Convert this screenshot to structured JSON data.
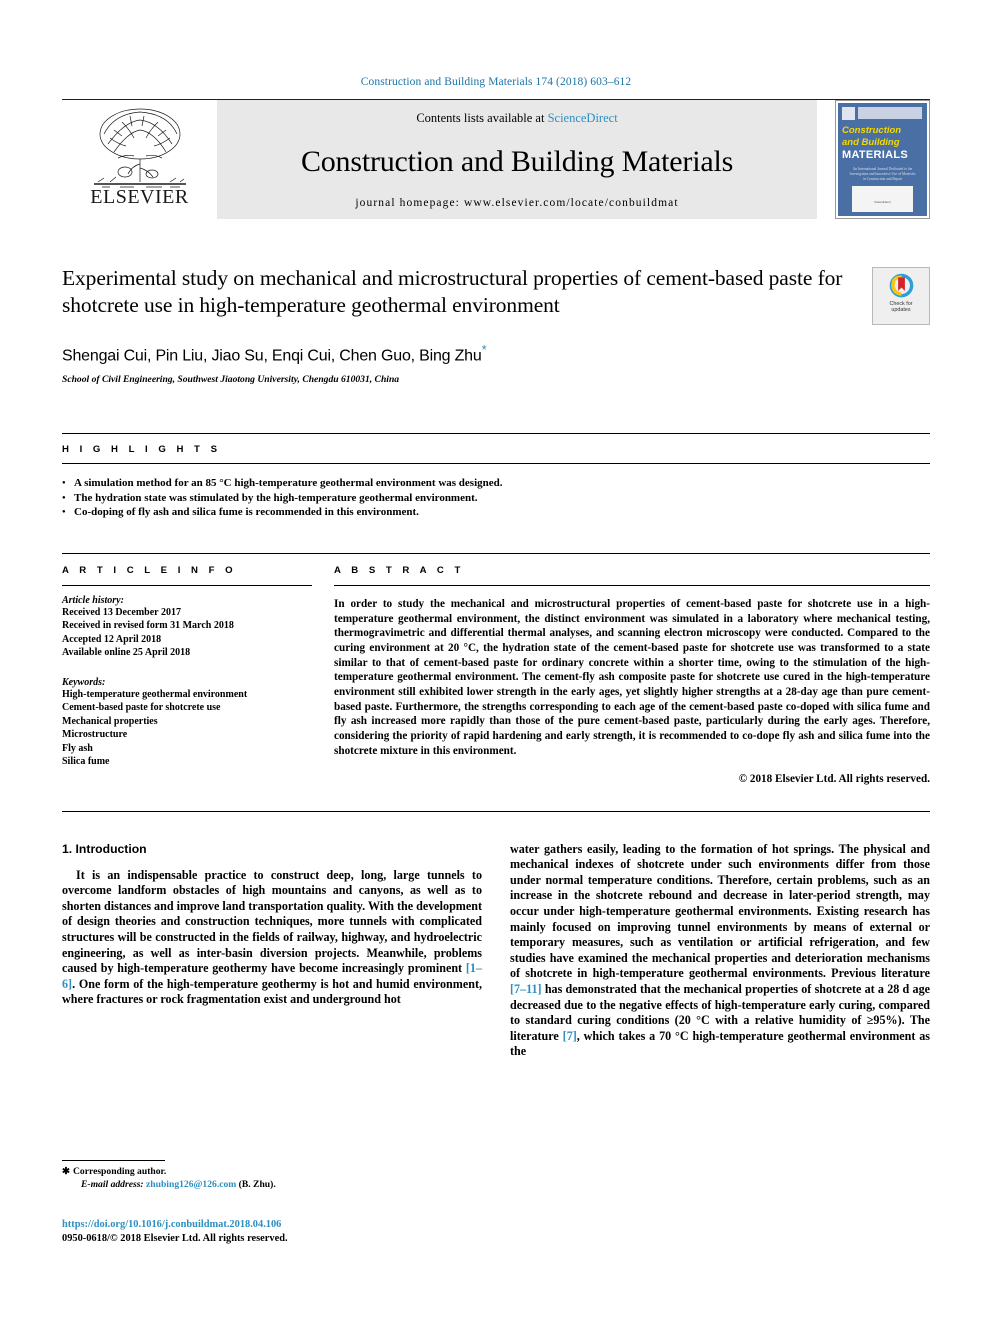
{
  "running_head": "Construction and Building Materials 174 (2018) 603–612",
  "masthead": {
    "publisher": "ELSEVIER",
    "publisher_logo_icon": "elsevier-tree-logo",
    "contents_prefix": "Contents lists available at ",
    "contents_link": "ScienceDirect",
    "journal_title": "Construction and Building Materials",
    "homepage": "journal homepage: www.elsevier.com/locate/conbuildmat",
    "cover": {
      "line1": "Construction",
      "line2": "and Building",
      "line3": "MATERIALS",
      "blurb": "An International Journal Dedicated to the Investigation and Innovative Use of Materials in Construction and Repair",
      "footer": "ScienceDirect"
    }
  },
  "article": {
    "title": "Experimental study on mechanical and microstructural properties of cement-based paste for shotcrete use in high-temperature geothermal environment",
    "authors": "Shengai Cui, Pin Liu, Jiao Su, Enqi Cui, Chen Guo, Bing Zhu",
    "corresponding_marker": "*",
    "affiliation": "School of Civil Engineering, Southwest Jiaotong University, Chengdu 610031, China",
    "crossmark_label_line1": "Check for",
    "crossmark_label_line2": "updates"
  },
  "highlights": {
    "heading": "H I G H L I G H T S",
    "items": [
      "A simulation method for an 85 °C high-temperature geothermal environment was designed.",
      "The hydration state was stimulated by the high-temperature geothermal environment.",
      "Co-doping of fly ash and silica fume is recommended in this environment."
    ]
  },
  "article_info": {
    "heading": "A R T I C L E    I N F O",
    "history_label": "Article history:",
    "history": [
      "Received 13 December 2017",
      "Received in revised form 31 March 2018",
      "Accepted 12 April 2018",
      "Available online 25 April 2018"
    ],
    "keywords_label": "Keywords:",
    "keywords": [
      "High-temperature geothermal environment",
      "Cement-based paste for shotcrete use",
      "Mechanical properties",
      "Microstructure",
      "Fly ash",
      "Silica fume"
    ]
  },
  "abstract": {
    "heading": "A B S T R A C T",
    "text": "In order to study the mechanical and microstructural properties of cement-based paste for shotcrete use in a high-temperature geothermal environment, the distinct environment was simulated in a laboratory where mechanical testing, thermogravimetric and differential thermal analyses, and scanning electron microscopy were conducted. Compared to the curing environment at 20 °C, the hydration state of the cement-based paste for shotcrete use was transformed to a state similar to that of cement-based paste for ordinary concrete within a shorter time, owing to the stimulation of the high-temperature geothermal environment. The cement-fly ash composite paste for shotcrete use cured in the high-temperature environment still exhibited lower strength in the early ages, yet slightly higher strengths at a 28-day age than pure cement-based paste. Furthermore, the strengths corresponding to each age of the cement-based paste co-doped with silica fume and fly ash increased more rapidly than those of the pure cement-based paste, particularly during the early ages. Therefore, considering the priority of rapid hardening and early strength, it is recommended to co-dope fly ash and silica fume into the shotcrete mixture in this environment.",
    "copyright": "© 2018 Elsevier Ltd. All rights reserved."
  },
  "introduction": {
    "heading": "1. Introduction",
    "left_paragraph_part1": "It is an indispensable practice to construct deep, long, large tunnels to overcome landform obstacles of high mountains and canyons, as well as to shorten distances and improve land transportation quality. With the development of design theories and construction techniques, more tunnels with complicated structures will be constructed in the fields of railway, highway, and hydroelectric engineering, as well as inter-basin diversion projects. Meanwhile, problems caused by high-temperature geothermy have become increasingly prominent ",
    "left_ref1": "[1–6]",
    "left_paragraph_part2": ". One form of the high-temperature geothermy is hot and humid environment, where fractures or rock fragmentation exist and underground hot",
    "right_part1": "water gathers easily, leading to the formation of hot springs. The physical and mechanical indexes of shotcrete under such environments differ from those under normal temperature conditions. Therefore, certain problems, such as an increase in the shotcrete rebound and decrease in later-period strength, may occur under high-temperature geothermal environments. Existing research has mainly focused on improving tunnel environments by means of external or temporary measures, such as ventilation or artificial refrigeration, and few studies have examined the mechanical properties and deterioration mechanisms of shotcrete in high-temperature geothermal environments. Previous literature ",
    "right_ref1": "[7–11]",
    "right_part2": " has demonstrated that the mechanical properties of shotcrete at a 28 d age decreased due to the negative effects of high-temperature early curing, compared to standard curing conditions (20 °C with a relative humidity of ≥95%). The literature ",
    "right_ref2": "[7]",
    "right_part3": ", which takes a 70 °C high-temperature geothermal environment as the"
  },
  "footer": {
    "corresponding_star": "✱",
    "corresponding_text": "Corresponding author.",
    "email_label": "E-mail address:",
    "email": "zhubing126@126.com",
    "email_suffix": " (B. Zhu).",
    "doi": "https://doi.org/10.1016/j.conbuildmat.2018.04.106",
    "issn": "0950-0618/© 2018 Elsevier Ltd. All rights reserved."
  },
  "colors": {
    "link": "#2e8fc0",
    "running_head": "#1a74a8",
    "masthead_bg": "#e8e8e8",
    "cover_blue": "#4a6fa5",
    "cover_yellow": "#f5d800",
    "elsevier_orange": "#e87722"
  }
}
